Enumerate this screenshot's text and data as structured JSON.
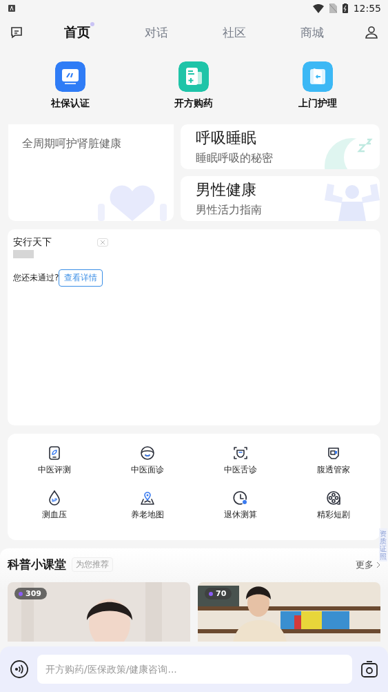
{
  "status_bar": {
    "time": "12:55"
  },
  "nav": {
    "tabs": [
      {
        "label": "首页",
        "selected": true
      },
      {
        "label": "对话",
        "selected": false
      },
      {
        "label": "社区",
        "selected": false
      },
      {
        "label": "商城",
        "selected": false
      }
    ]
  },
  "shortcuts": [
    {
      "label": "社保认证",
      "kind": "card",
      "color": "#2f7cf6"
    },
    {
      "label": "开方购药",
      "kind": "prescription",
      "color": "#1fc4a8"
    },
    {
      "label": "上门护理",
      "kind": "door",
      "color": "#3cb8f5"
    }
  ],
  "feature_cards": {
    "left": {
      "subtitle": "全周期呵护肾脏健康"
    },
    "right": [
      {
        "title": "呼吸睡眠",
        "subtitle": "睡眠呼吸的秘密",
        "kind": "sleep"
      },
      {
        "title": "男性健康",
        "subtitle": "男性活力指南",
        "kind": "muscle"
      }
    ]
  },
  "ad": {
    "title": "安行天下",
    "message": "您还未通过?",
    "button": "查看详情"
  },
  "services": [
    {
      "label": "中医评测",
      "kind": "leaf"
    },
    {
      "label": "中医面诊",
      "kind": "face"
    },
    {
      "label": "中医舌诊",
      "kind": "scan"
    },
    {
      "label": "腹透管家",
      "kind": "device"
    },
    {
      "label": "测血压",
      "kind": "drop"
    },
    {
      "label": "养老地图",
      "kind": "map"
    },
    {
      "label": "退休测算",
      "kind": "clock"
    },
    {
      "label": "精彩短剧",
      "kind": "reel"
    }
  ],
  "course": {
    "title": "科普小课堂",
    "tag": "为您推荐",
    "more": "更多",
    "videos": [
      {
        "views": "309",
        "kind": "curtain"
      },
      {
        "views": "70",
        "kind": "bookshelf"
      }
    ]
  },
  "side_badge": "资质证照",
  "input": {
    "placeholder": "开方购药/医保政策/健康咨询..."
  }
}
